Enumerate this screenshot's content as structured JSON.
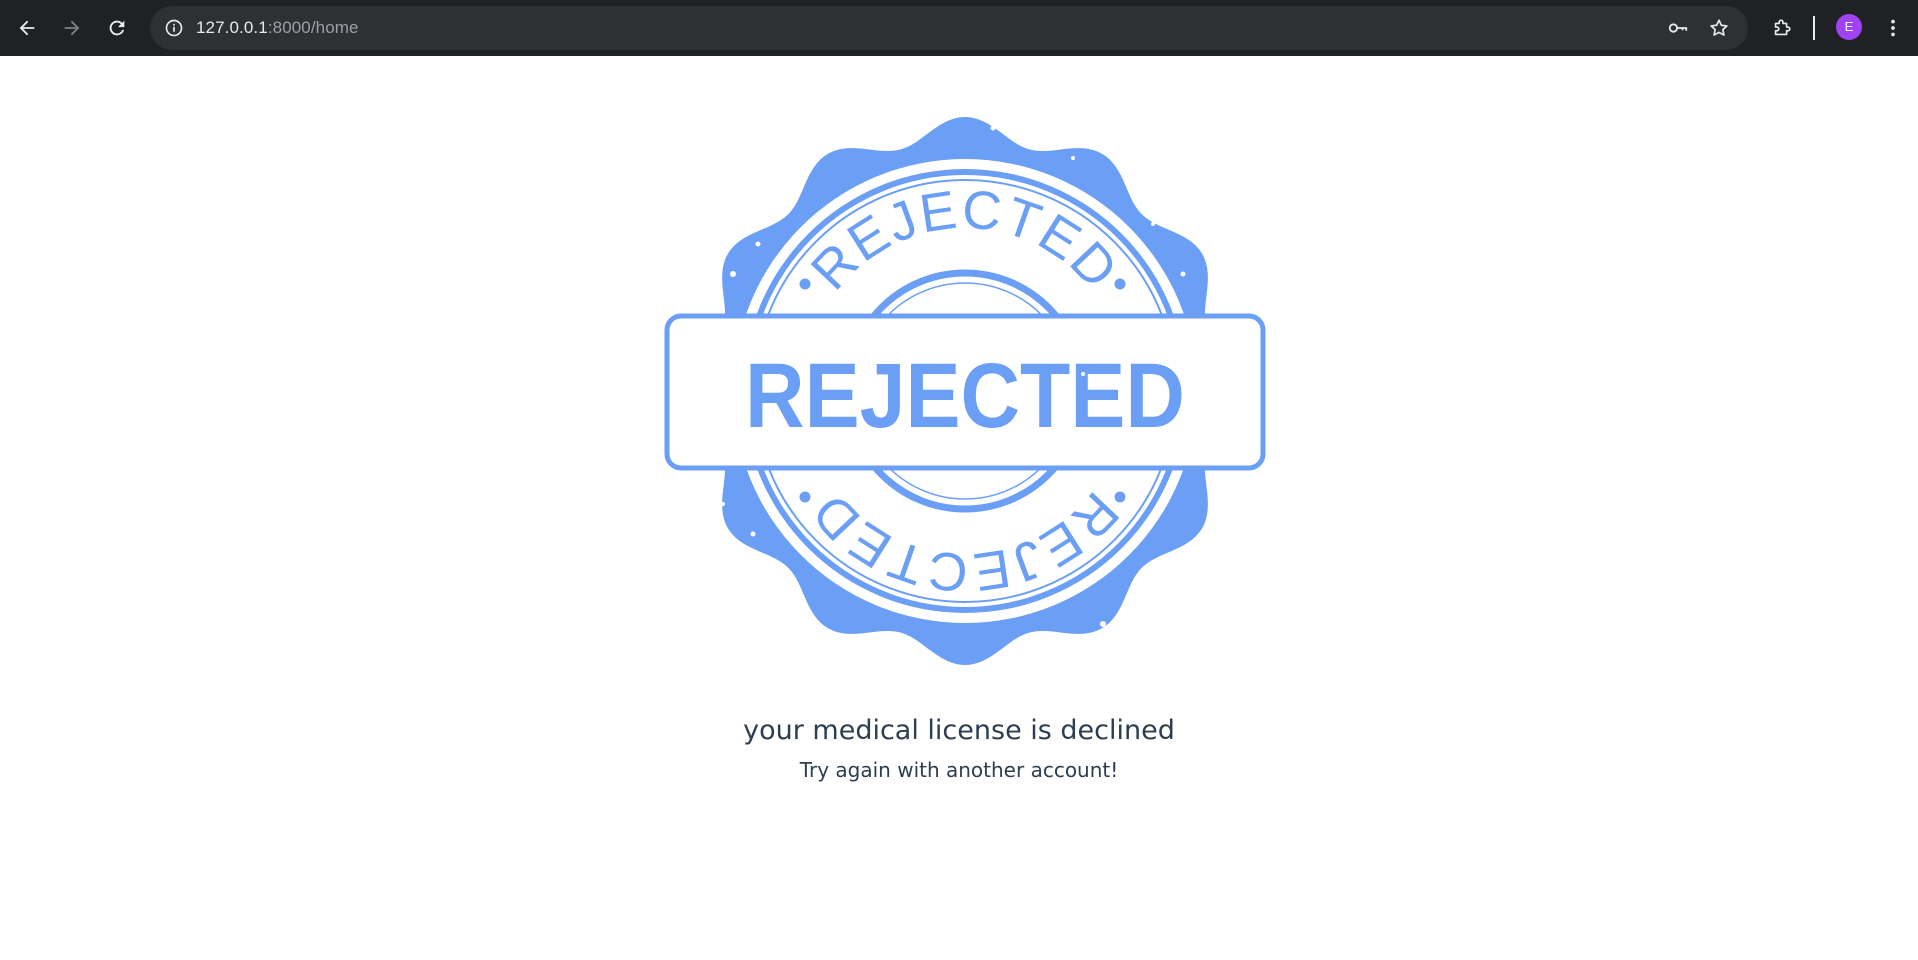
{
  "browser": {
    "url_host": "127.0.0.1",
    "url_rest": ":8000/home",
    "profile_initial": "E",
    "profile_color": "#a142f4"
  },
  "stamp": {
    "top_text": "REJECTED",
    "center_text": "REJECTED",
    "bottom_text": "REJECTED",
    "color": "#6b9ff5"
  },
  "message": {
    "title": "your medical license is declined",
    "subtitle": "Try again with another account!"
  },
  "icons": [
    "back-arrow-icon",
    "forward-arrow-icon",
    "reload-icon",
    "site-info-icon",
    "password-key-icon",
    "bookmark-star-icon",
    "extensions-puzzle-icon",
    "more-menu-icon"
  ]
}
